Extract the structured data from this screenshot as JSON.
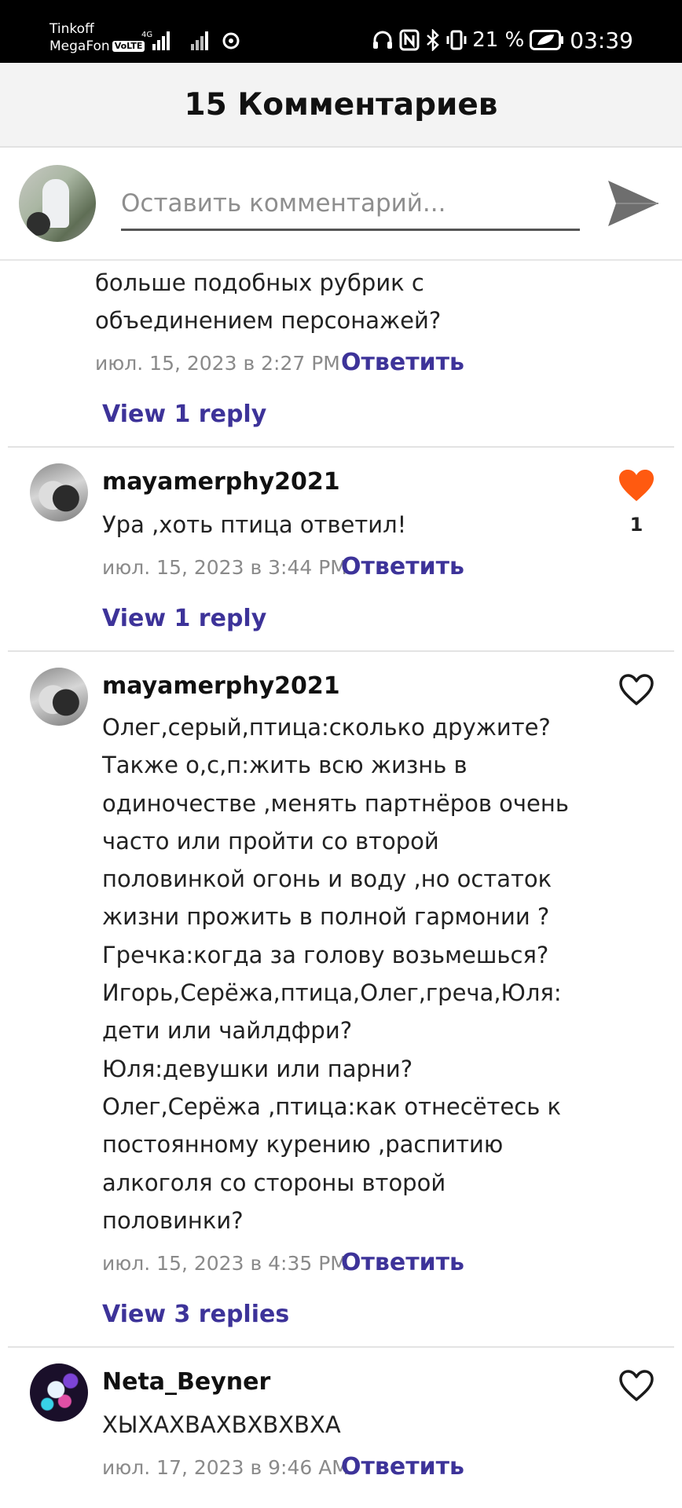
{
  "status_bar": {
    "carrier1": "Tinkoff",
    "carrier2": "MegaFon",
    "volte": "VoLTE",
    "network": "4G",
    "battery_percent": "21 %",
    "time": "03:39"
  },
  "header": {
    "title": "15 Комментариев"
  },
  "compose": {
    "placeholder": "Оставить комментарий..."
  },
  "comments": [
    {
      "text": "больше подобных рубрик с\nобъединением персонажей?",
      "date": "июл. 15, 2023 в 2:27 PM",
      "reply_label": "Ответить",
      "replies_label": "View 1 reply"
    },
    {
      "username": "mayamerphy2021",
      "text": "Ура ,хоть птица ответил!",
      "date": "июл. 15, 2023 в 3:44 PM",
      "reply_label": "Ответить",
      "replies_label": "View 1 reply",
      "like_count": "1",
      "liked": true
    },
    {
      "username": "mayamerphy2021",
      "text": "Олег,серый,птица:сколько дружите?\nТакже о,с,п:жить всю жизнь в\nодиночестве ,менять партнёров очень\nчасто или пройти со второй\nполовинкой огонь и воду ,но остаток\nжизни прожить в полной гармонии ?\nГречка:когда за голову возьмешься?\nИгорь,Серёжа,птица,Олег,греча,Юля:\nдети или чайлдфри?\nЮля:девушки или парни?\nОлег,Серёжа ,птица:как отнесётесь к\nпостоянному курению ,распитию\nалкоголя со стороны второй\nполовинки?",
      "date": "июл. 15, 2023 в 4:35 PM",
      "reply_label": "Ответить",
      "replies_label": "View 3 replies",
      "liked": false
    },
    {
      "username": "Neta_Beyner",
      "text": "ХЫХАХВАХВХВХВХА",
      "date": "июл. 17, 2023 в 9:46 AM",
      "reply_label": "Ответить",
      "liked": false
    }
  ],
  "colors": {
    "accent": "#3d3399",
    "like_active": "#ff5a10",
    "header_bg": "#f3f3f3"
  }
}
